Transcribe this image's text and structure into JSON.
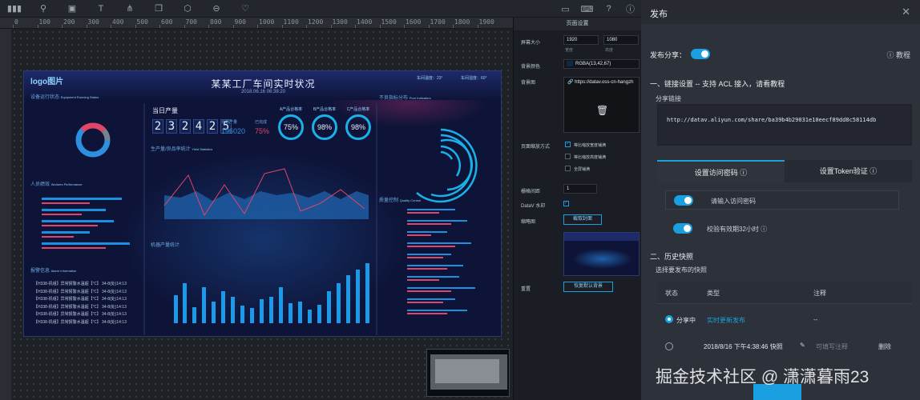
{
  "ruler": [
    "0",
    "100",
    "200",
    "300",
    "400",
    "500",
    "600",
    "700",
    "800",
    "900",
    "1000",
    "1100",
    "1200",
    "1300",
    "1400",
    "1500",
    "1600",
    "1700",
    "1800",
    "1900"
  ],
  "screen": {
    "logo": "logo图片",
    "title": "某某工厂车间实时状况",
    "date": "2018.06.16 06:38:20",
    "temp1": "车间温度：23°",
    "temp2": "车间湿度：60°",
    "equip_status": "设备运行状态",
    "equip_status_en": "Equipment Running Status",
    "today_output": "当日产量",
    "digits": [
      "2",
      "3",
      "2",
      "4",
      "2",
      "5"
    ],
    "plan_label": "计划产量",
    "plan_value": "196020",
    "done_label": "已完成",
    "done_value": "75%",
    "gauges": [
      {
        "label": "A产品合格率",
        "value": "75%"
      },
      {
        "label": "B产品合格率",
        "value": "98%"
      },
      {
        "label": "C产品合格率",
        "value": "98%"
      }
    ],
    "indicators": "不良指标分布",
    "indicators_en": "Poor Indicators",
    "product_stats": "生产量/良品率统计",
    "product_stats_en": "Yield Statistics",
    "performance": "人员绩效",
    "performance_en": "Workers Performance",
    "quality": "质量控制",
    "quality_en": "Quality Control",
    "group_stats": "机器产量统计",
    "warn_title": "报警信息",
    "warn_title_en": "Alarm Information",
    "warn_items": [
      "【H338-机组】异常报警水温超【℃】 34-8(处)14:13",
      "【H338-机组】异常报警水温超【℃】 34-8(处)14:13",
      "【H338-机组】异常报警水温超【℃】 34-8(处)14:13",
      "【H338-机组】异常报警水温超【℃】 34-8(处)14:13",
      "【H338-机组】异常报警水温超【℃】 34-8(处)14:13",
      "【H338-机组】异常报警水温超【℃】 34-8(处)14:13"
    ]
  },
  "settings": {
    "title": "页面设置",
    "screen_size_label": "屏幕大小",
    "width": "1920",
    "height": "1080",
    "width_sub": "宽度",
    "height_sub": "高度",
    "bg_color_label": "背景颜色",
    "bg_color_value": "RGBA(13,42,67)",
    "bg_image_label": "背景图",
    "bg_image_url": "https://datav.oss-cn-hangzh",
    "scale_label": "页面缩放方式",
    "scale_options": [
      "等比缩放宽度铺满",
      "等比缩放高度铺满",
      "全屏铺满"
    ],
    "grid_label": "栅格间距",
    "grid_value": "1",
    "watermark_label": "DataV 水印",
    "thumb_label": "缩略图",
    "capture_button": "截取封面",
    "reset_label": "重置",
    "reset_button": "恢复默认背景"
  },
  "publish": {
    "title": "发布",
    "share_label": "发布分享：",
    "tutorial": "教程",
    "section1": "一、链接设置 -- 支持 ACL 接入，请看教程",
    "share_link_label": "分享链接",
    "share_link": "http://datav.aliyun.com/share/ba39b4b29031e10eecf89dd8c58114db",
    "tab_password": "设置访问密码",
    "tab_token": "设置Token验证",
    "password_placeholder": "请输入访问密码",
    "token_valid": "校验有效期32小时",
    "section2": "二、历史快照",
    "choose_snapshot": "选择要发布的快照",
    "col_status": "状态",
    "col_type": "类型",
    "col_note": "注释",
    "rows": [
      {
        "status": "分享中",
        "type": "实时更新发布",
        "note": "--",
        "action": ""
      },
      {
        "status": "",
        "type": "2018/8/16 下午4:38:46 快照",
        "note": "可填写注释",
        "action": "删除"
      }
    ]
  },
  "watermark": "掘金技术社区 @ 潇潇暮雨23"
}
